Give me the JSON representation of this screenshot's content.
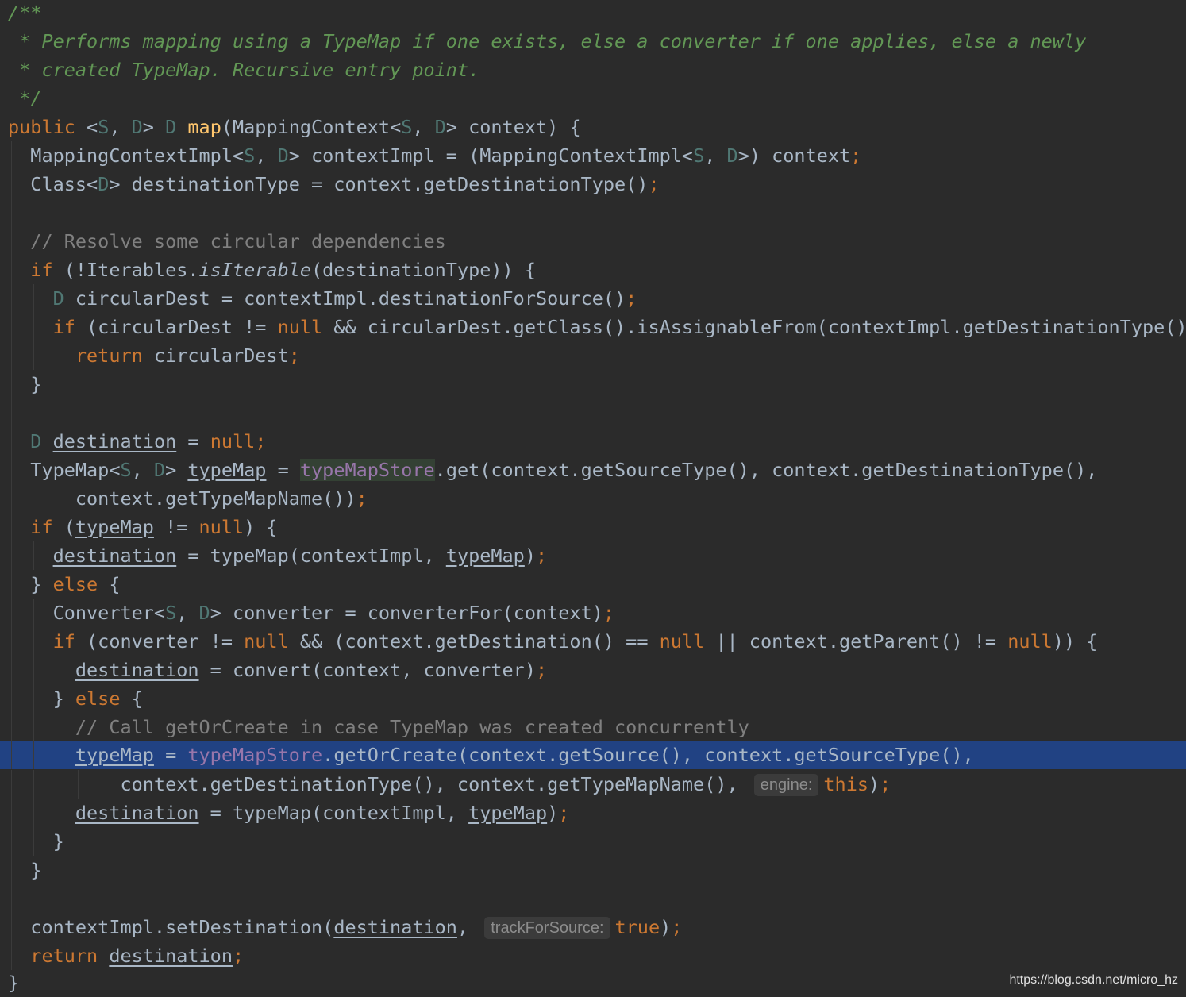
{
  "editor": {
    "highlight_line": 27,
    "colors": {
      "background": "#2b2b2b",
      "default_text": "#a9b7c6",
      "keyword": "#cc7832",
      "doc_comment": "#629755",
      "line_comment": "#808080",
      "type_param": "#507874",
      "method_decl": "#ffc66d",
      "field": "#9876aa",
      "selection": "#214283"
    },
    "doc": {
      "l1": "/**",
      "l2": " * Performs mapping using a TypeMap if one exists, else a converter if one applies, else a newly",
      "l3": " * created TypeMap. Recursive entry point.",
      "l4": " */"
    },
    "comments": {
      "resolve": "// Resolve some circular dependencies",
      "call": "// Call getOrCreate in case TypeMap was created concurrently"
    },
    "hints": {
      "engine": "engine:",
      "trackForSource": "trackForSource:"
    }
  },
  "watermark": "https://blog.csdn.net/micro_hz"
}
